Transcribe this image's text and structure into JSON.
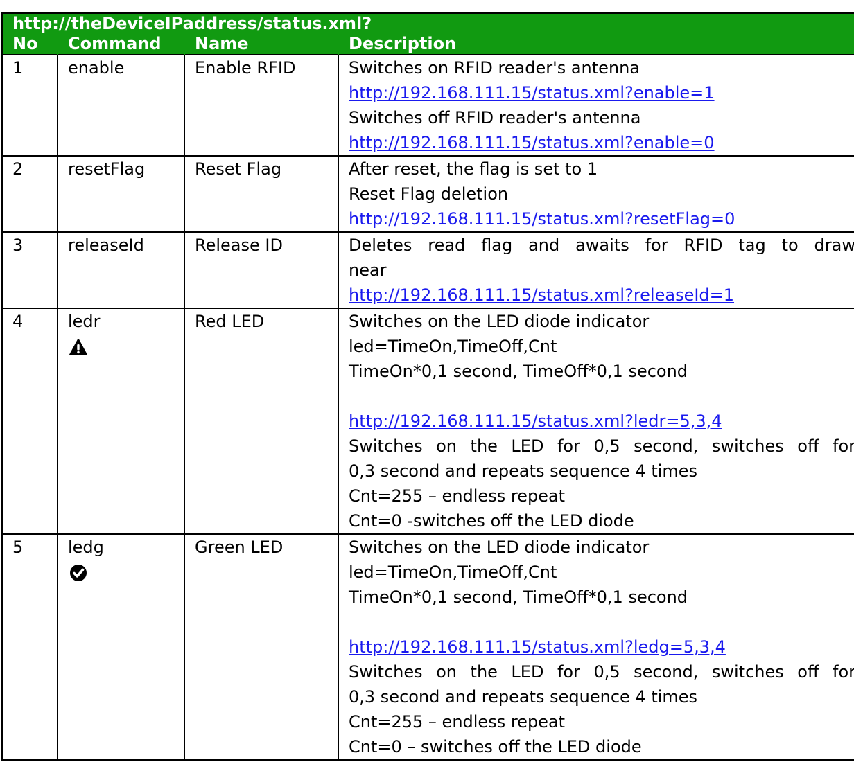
{
  "title": "http://theDeviceIPaddress/status.xml?",
  "headers": {
    "no": "No",
    "command": "Command",
    "name": "Name",
    "description": "Description"
  },
  "rows": [
    {
      "no": "1",
      "command": "enable",
      "name": "Enable RFID",
      "lines": [
        "Switches on RFID reader's antenna",
        "http://192.168.111.15/status.xml?enable=1",
        "Switches off RFID reader's antenna",
        "http://192.168.111.15/status.xml?enable=0"
      ]
    },
    {
      "no": "2",
      "command": "resetFlag",
      "name": "Reset Flag",
      "lines": [
        "After reset, the flag is set to 1",
        "Reset Flag deletion",
        "http://192.168.111.15/status.xml?resetFlag=0"
      ]
    },
    {
      "no": "3",
      "command": "releaseId",
      "name": "Release ID",
      "lines": [
        "Deletes read flag and awaits for RFID tag to draw",
        "near",
        "http://192.168.111.15/status.xml?releaseId=1"
      ]
    },
    {
      "no": "4",
      "command": "ledr",
      "name": "Red LED",
      "icon": "warning-icon",
      "lines": [
        "Switches on the LED diode indicator",
        "led=TimeOn,TimeOff,Cnt",
        "TimeOn*0,1 second, TimeOff*0,1 second",
        "http://192.168.111.15/status.xml?ledr=5,3,4",
        "Switches on the LED for 0,5 second, switches off for",
        "0,3 second and repeats sequence 4 times",
        "Cnt=255 – endless repeat",
        "Cnt=0 -switches off the LED diode"
      ]
    },
    {
      "no": "5",
      "command": "ledg",
      "name": "Green LED",
      "icon": "checkmark-icon",
      "lines": [
        "Switches on the LED diode indicator",
        "led=TimeOn,TimeOff,Cnt",
        "TimeOn*0,1 second, TimeOff*0,1 second",
        "http://192.168.111.15/status.xml?ledg=5,3,4",
        "Switches on the LED for 0,5 second, switches off for",
        "0,3 second and repeats sequence 4 times",
        "Cnt=255 – endless repeat",
        "Cnt=0 – switches off the LED diode"
      ]
    }
  ],
  "colors": {
    "header_bg": "#119a11",
    "link": "#1a1aee"
  }
}
